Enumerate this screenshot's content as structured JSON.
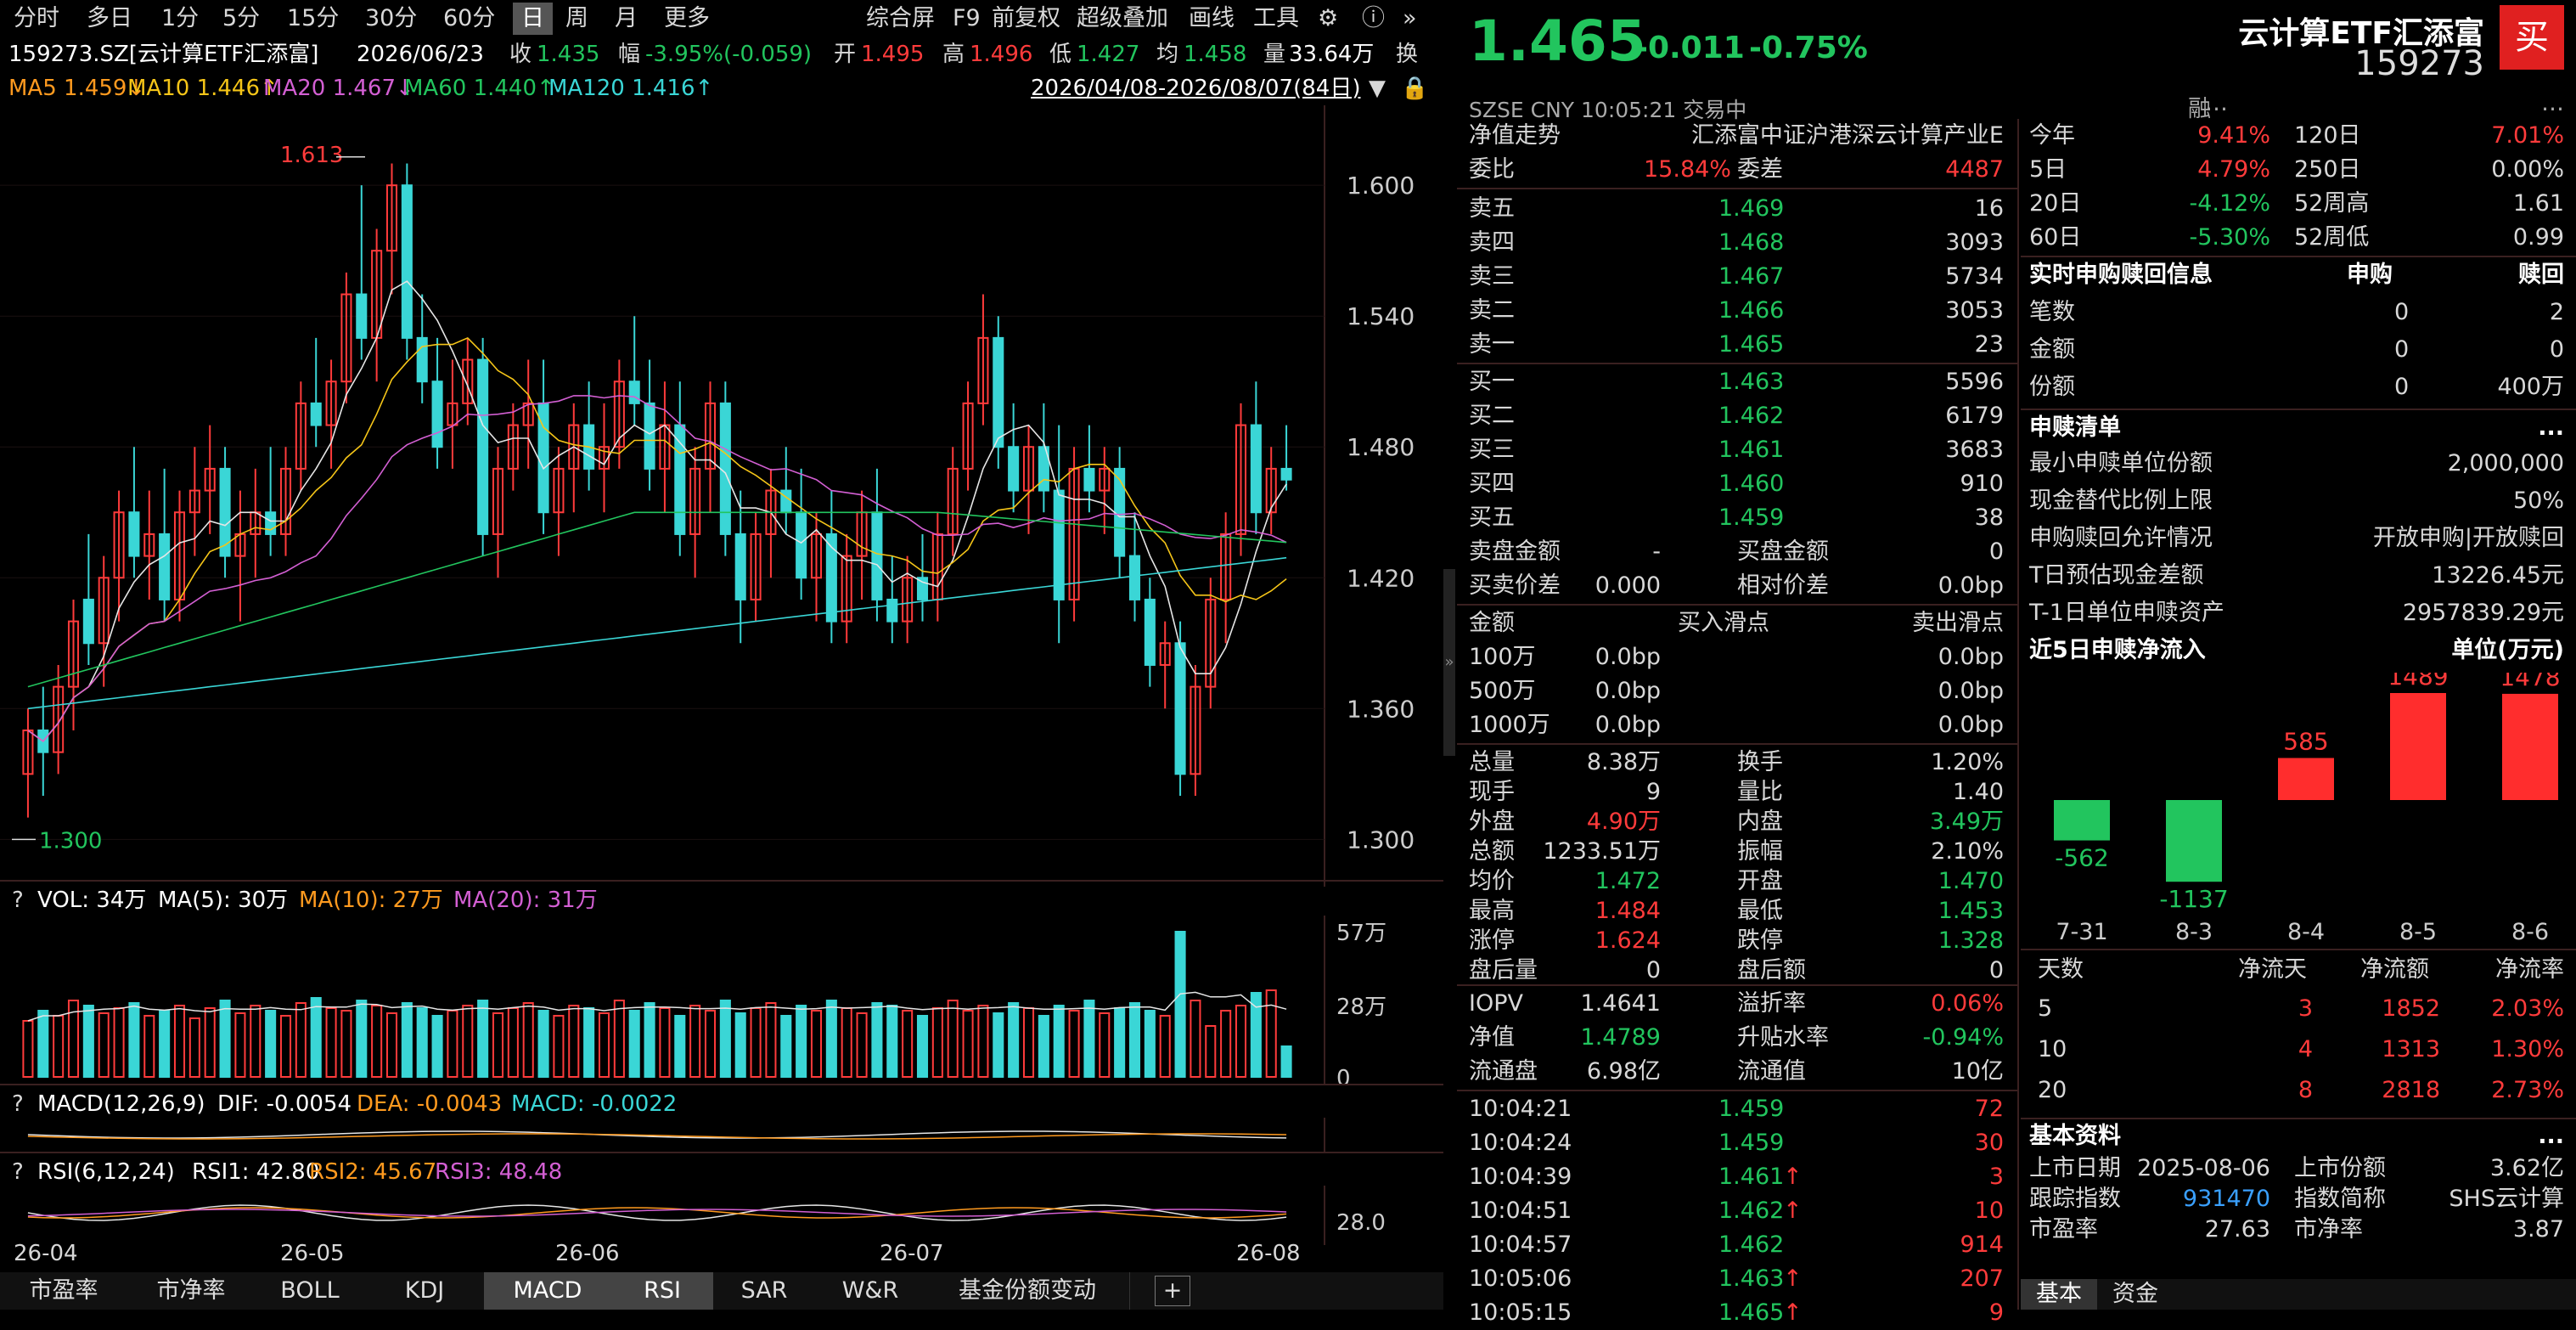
{
  "toolbar": {
    "periods": [
      "分时",
      "多日",
      "1分",
      "5分",
      "15分",
      "30分",
      "60分",
      "日",
      "周",
      "月",
      "更多"
    ],
    "active_period": "日",
    "tools": [
      "综合屏",
      "F9",
      "前复权",
      "超级叠加",
      "画线",
      "工具"
    ],
    "icons": [
      "gear-icon",
      "help-icon",
      "expand-icon"
    ]
  },
  "quote_bar": {
    "code_name": "159273.SZ[云计算ETF汇添富]",
    "date": "2026/06/23",
    "close_label": "收",
    "close": "1.435",
    "change_label": "幅",
    "change": "-3.95%(-0.059)",
    "open_label": "开",
    "open": "1.495",
    "high_label": "高",
    "high": "1.496",
    "low_label": "低",
    "low": "1.427",
    "avg_label": "均",
    "avg": "1.458",
    "vol_label": "量",
    "vol": "33.64万",
    "turnover_label": "换"
  },
  "ma_bar": {
    "ma5": "MA5 1.459↓",
    "ma10": "MA10 1.446↑",
    "ma20": "MA20 1.467↓",
    "ma60": "MA60 1.440↑",
    "ma120": "MA120 1.416↑",
    "range": "2026/04/08-2026/08/07(84日)"
  },
  "colors": {
    "up": "#ff3b3b",
    "down": "#3ad6d6",
    "green": "#22c55e",
    "yellow": "#f5c518",
    "magenta": "#d35fd3",
    "accent_buy": "#e02020"
  },
  "chart_data": {
    "type": "candlestick",
    "price_axis": [
      "1.600",
      "1.540",
      "1.480",
      "1.420",
      "1.360",
      "1.300"
    ],
    "ylim": [
      1.29,
      1.625
    ],
    "x_labels": [
      "26-04",
      "26-05",
      "26-06",
      "26-07",
      "26-08"
    ],
    "annotations": {
      "high": "1.613",
      "low": "1.300"
    },
    "vol_axis": [
      "57万",
      "28万",
      "0"
    ],
    "rsi_axis": "28.0"
  },
  "vol_legend": {
    "q": "?",
    "vol": "VOL: 34万",
    "ma5": "MA(5): 30万",
    "ma10": "MA(10): 27万",
    "ma20": "MA(20): 31万"
  },
  "macd_legend": {
    "q": "?",
    "title": "MACD(12,26,9)",
    "dif": "DIF: -0.0054",
    "dea": "DEA: -0.0043",
    "macd": "MACD: -0.0022"
  },
  "rsi_legend": {
    "q": "?",
    "title": "RSI(6,12,24)",
    "rsi1": "RSI1: 42.80",
    "rsi2": "RSI2: 45.67",
    "rsi3": "RSI3: 48.48"
  },
  "bottom_tabs": [
    "市盈率",
    "市净率",
    "BOLL",
    "KDJ",
    "MACD",
    "RSI",
    "SAR",
    "W&R",
    "基金份额变动"
  ],
  "active_bottom_tab": "MACD",
  "header": {
    "price": "1.465",
    "change": "-0.011",
    "change_pct": "-0.75%",
    "name": "云计算ETF汇添富",
    "code": "159273",
    "buy": "买",
    "market": "SZSE",
    "currency": "CNY",
    "time": "10:05:21",
    "status": "交易中",
    "rong": "融"
  },
  "nav": {
    "label": "净值走势",
    "fund": "汇添富中证沪港深云计算产业E"
  },
  "weibi": {
    "l1": "委比",
    "v1": "15.84%",
    "l2": "委差",
    "v2": "4487"
  },
  "asks": [
    {
      "label": "卖五",
      "price": "1.469",
      "vol": "16"
    },
    {
      "label": "卖四",
      "price": "1.468",
      "vol": "3093"
    },
    {
      "label": "卖三",
      "price": "1.467",
      "vol": "5734"
    },
    {
      "label": "卖二",
      "price": "1.466",
      "vol": "3053"
    },
    {
      "label": "卖一",
      "price": "1.465",
      "vol": "23"
    }
  ],
  "bids": [
    {
      "label": "买一",
      "price": "1.463",
      "vol": "5596"
    },
    {
      "label": "买二",
      "price": "1.462",
      "vol": "6179"
    },
    {
      "label": "买三",
      "price": "1.461",
      "vol": "3683"
    },
    {
      "label": "买四",
      "price": "1.460",
      "vol": "910"
    },
    {
      "label": "买五",
      "price": "1.459",
      "vol": "38"
    }
  ],
  "spread": [
    {
      "l1": "卖盘金额",
      "v1": "-",
      "l2": "买盘金额",
      "v2": "0"
    },
    {
      "l1": "买卖价差",
      "v1": "0.000",
      "l2": "相对价差",
      "v2": "0.0bp"
    }
  ],
  "slip_header": {
    "c1": "金额",
    "c2": "买入滑点",
    "c3": "卖出滑点"
  },
  "slip": [
    {
      "amt": "100万",
      "buy": "0.0bp",
      "sell": "0.0bp"
    },
    {
      "amt": "500万",
      "buy": "0.0bp",
      "sell": "0.0bp"
    },
    {
      "amt": "1000万",
      "buy": "0.0bp",
      "sell": "0.0bp"
    }
  ],
  "stats": [
    {
      "l1": "总量",
      "v1": "8.38万",
      "l2": "换手",
      "v2": "1.20%"
    },
    {
      "l1": "现手",
      "v1": "9",
      "l2": "量比",
      "v2": "1.40"
    },
    {
      "l1": "外盘",
      "v1": "4.90万",
      "l2": "内盘",
      "v2": "3.49万"
    },
    {
      "l1": "总额",
      "v1": "1233.51万",
      "l2": "振幅",
      "v2": "2.10%"
    },
    {
      "l1": "均价",
      "v1": "1.472",
      "l2": "开盘",
      "v2": "1.470"
    },
    {
      "l1": "最高",
      "v1": "1.484",
      "l2": "最低",
      "v2": "1.453"
    },
    {
      "l1": "涨停",
      "v1": "1.624",
      "l2": "跌停",
      "v2": "1.328"
    },
    {
      "l1": "盘后量",
      "v1": "0",
      "l2": "盘后额",
      "v2": "0"
    }
  ],
  "iopv": [
    {
      "l1": "IOPV",
      "v1": "1.4641",
      "l2": "溢折率",
      "v2": "0.06%"
    },
    {
      "l1": "净值",
      "v1": "1.4789",
      "l2": "升贴水率",
      "v2": "-0.94%"
    },
    {
      "l1": "流通盘",
      "v1": "6.98亿",
      "l2": "流通值",
      "v2": "10亿"
    }
  ],
  "ticks": [
    {
      "time": "10:04:21",
      "price": "1.459",
      "vol": "72",
      "arrow": ""
    },
    {
      "time": "10:04:24",
      "price": "1.459",
      "vol": "30",
      "arrow": ""
    },
    {
      "time": "10:04:39",
      "price": "1.461",
      "vol": "3",
      "arrow": "↑"
    },
    {
      "time": "10:04:51",
      "price": "1.462",
      "vol": "10",
      "arrow": "↑"
    },
    {
      "time": "10:04:57",
      "price": "1.462",
      "vol": "914",
      "arrow": ""
    },
    {
      "time": "10:05:06",
      "price": "1.463",
      "vol": "207",
      "arrow": "↑"
    },
    {
      "time": "10:05:15",
      "price": "1.465",
      "vol": "9",
      "arrow": "↑"
    }
  ],
  "perf": [
    {
      "l1": "今年",
      "v1": "9.41%",
      "l2": "120日",
      "v2": "7.01%"
    },
    {
      "l1": "5日",
      "v1": "4.79%",
      "l2": "250日",
      "v2": "0.00%"
    },
    {
      "l1": "20日",
      "v1": "-4.12%",
      "l2": "52周高",
      "v2": "1.61"
    },
    {
      "l1": "60日",
      "v1": "-5.30%",
      "l2": "52周低",
      "v2": "0.99"
    }
  ],
  "sub_info": {
    "title": "实时申购赎回信息",
    "c1": "申购",
    "c2": "赎回",
    "rows": [
      {
        "l": "笔数",
        "a": "0",
        "b": "2"
      },
      {
        "l": "金额",
        "a": "0",
        "b": "0"
      },
      {
        "l": "份额",
        "a": "0",
        "b": "400万"
      }
    ]
  },
  "sub_list": {
    "title": "申赎清单",
    "more": "...",
    "rows": [
      {
        "l": "最小申赎单位份额",
        "v": "2,000,000"
      },
      {
        "l": "现金替代比例上限",
        "v": "50%"
      },
      {
        "l": "申购赎回允许情况",
        "v": "开放申购|开放赎回"
      },
      {
        "l": "T日预估现金差额",
        "v": "13226.45元"
      },
      {
        "l": "T-1日单位申赎资产",
        "v": "2957839.29元"
      }
    ]
  },
  "flow": {
    "title": "近5日申赎净流入",
    "unit": "单位(万元)",
    "bars": [
      {
        "date": "7-31",
        "value": -562
      },
      {
        "date": "8-3",
        "value": -1137
      },
      {
        "date": "8-4",
        "value": 585
      },
      {
        "date": "8-5",
        "value": 1489
      },
      {
        "date": "8-6",
        "value": 1478
      }
    ]
  },
  "flow_table": {
    "headers": [
      "天数",
      "净流天",
      "净流额",
      "净流率"
    ],
    "rows": [
      {
        "d": "5",
        "n": "3",
        "amt": "1852",
        "rate": "2.03%"
      },
      {
        "d": "10",
        "n": "4",
        "amt": "1313",
        "rate": "1.30%"
      },
      {
        "d": "20",
        "n": "8",
        "amt": "2818",
        "rate": "2.73%"
      }
    ]
  },
  "basic": {
    "title": "基本资料",
    "more": "...",
    "rows": [
      {
        "l1": "上市日期",
        "v1": "2025-08-06",
        "l2": "上市份额",
        "v2": "3.62亿"
      },
      {
        "l1": "跟踪指数",
        "v1": "931470",
        "l2": "指数简称",
        "v2": "SHS云计算"
      },
      {
        "l1": "市盈率",
        "v1": "27.63",
        "l2": "市净率",
        "v2": "3.87"
      }
    ]
  },
  "right_tabs": [
    "基本",
    "资金"
  ]
}
